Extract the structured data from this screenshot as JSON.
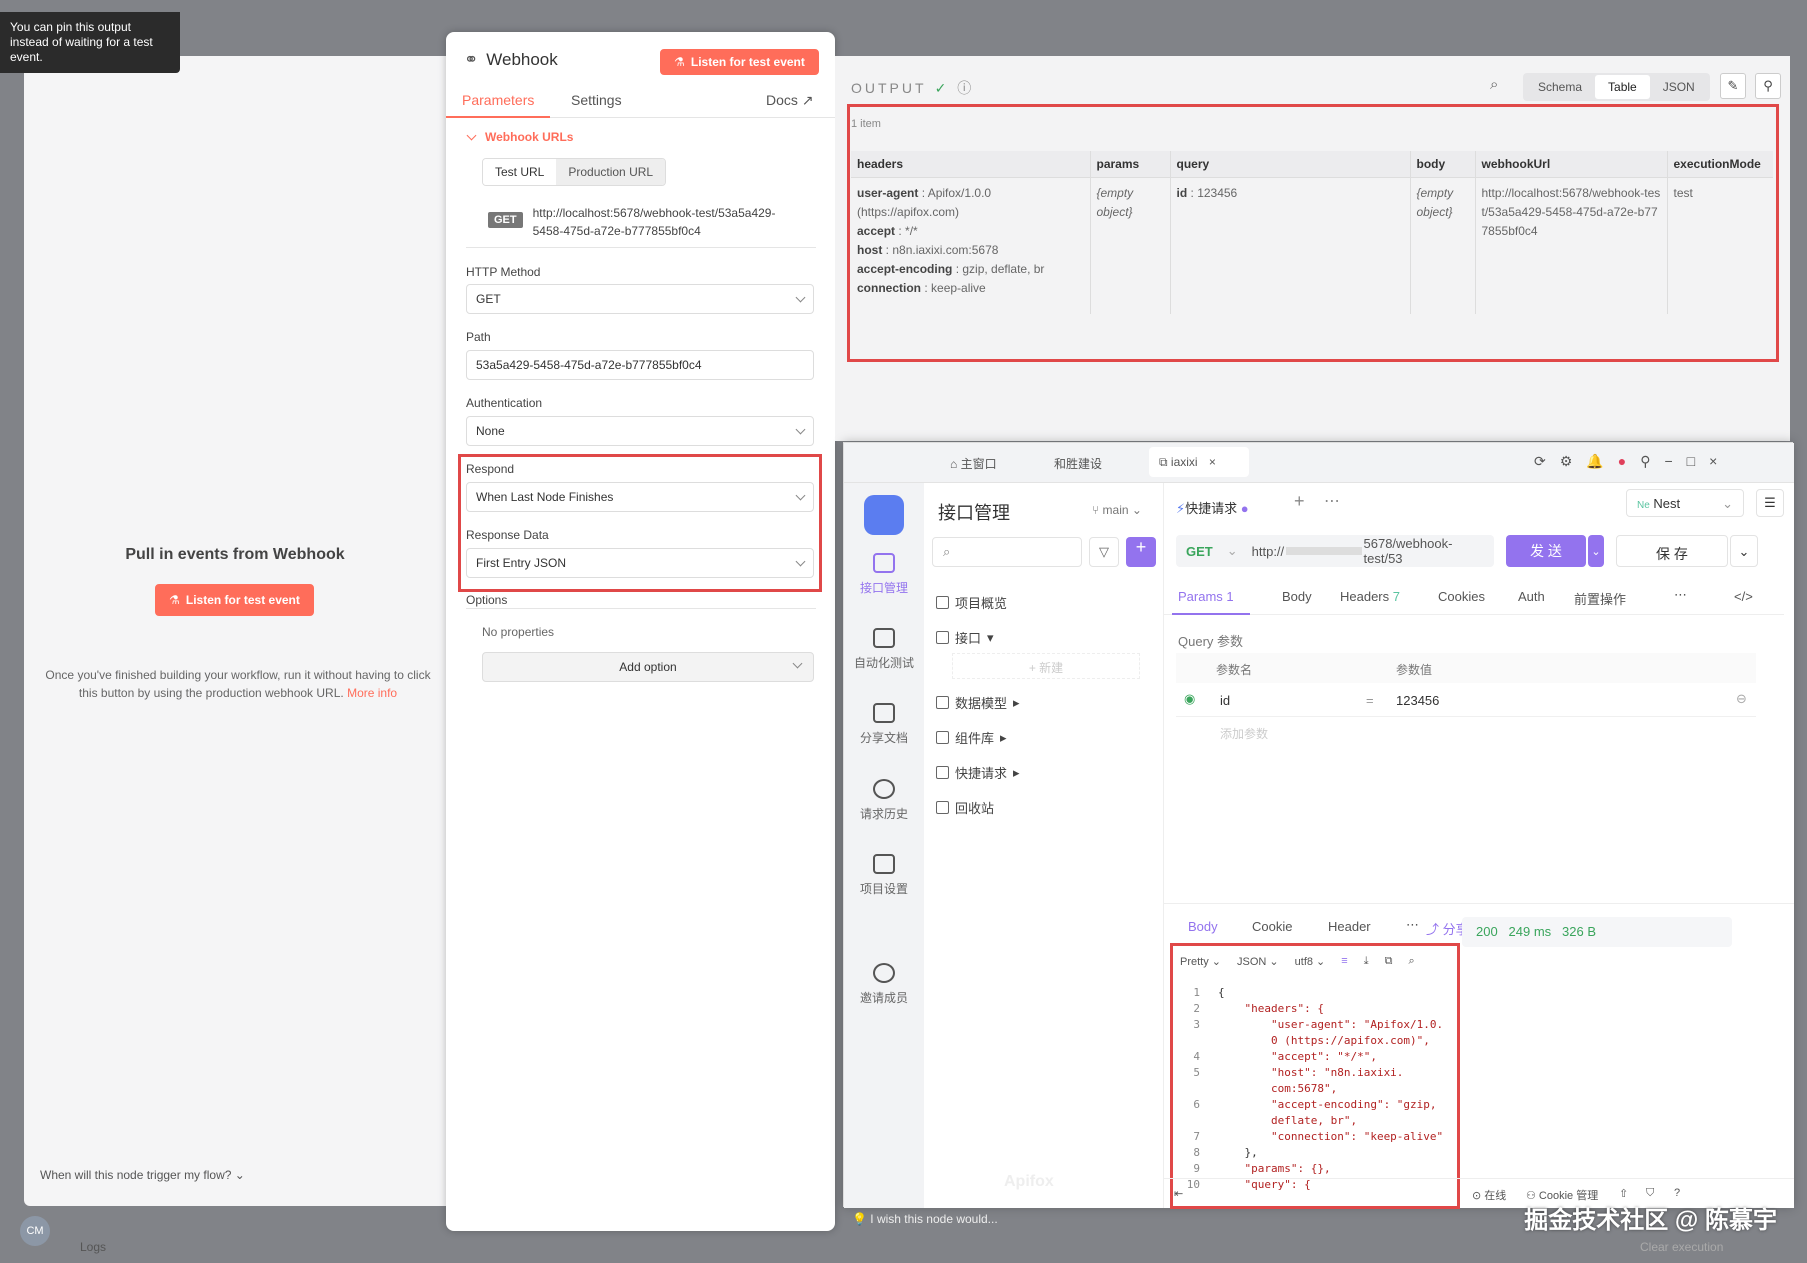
{
  "tooltip": {
    "text": "You can pin this output instead of waiting for a test event."
  },
  "left_pane": {
    "title": "Pull in events from Webhook",
    "listen_button": "Listen for test event",
    "description": "Once you've finished building your workflow, run it without having to click this button by using the production webhook URL.",
    "more_info": "More info",
    "trigger_question": "When will this node trigger my flow?",
    "logs_label": "Logs",
    "avatar_initials": "CM"
  },
  "node_panel": {
    "title": "Webhook",
    "listen_button": "Listen for test event",
    "tabs": [
      "Parameters",
      "Settings"
    ],
    "docs_label": "Docs",
    "webhook_urls_title": "Webhook URLs",
    "url_tabs": [
      "Test URL",
      "Production URL"
    ],
    "method_badge": "GET",
    "url_line1": "http://localhost:5678/webhook-test/53a5a429-",
    "url_line2": "5458-475d-a72e-b777855bf0c4",
    "http_method_label": "HTTP Method",
    "http_method_value": "GET",
    "path_label": "Path",
    "path_value": "53a5a429-5458-475d-a72e-b777855bf0c4",
    "auth_label": "Authentication",
    "auth_value": "None",
    "respond_label": "Respond",
    "respond_value": "When Last Node Finishes",
    "response_data_label": "Response Data",
    "response_data_value": "First Entry JSON",
    "options_label": "Options",
    "no_properties": "No properties",
    "add_option": "Add option"
  },
  "output": {
    "title": "OUTPUT",
    "view_modes": [
      "Schema",
      "Table",
      "JSON"
    ],
    "active_view": "Table",
    "item_count": "1 item",
    "columns": [
      "headers",
      "params",
      "query",
      "body",
      "webhookUrl",
      "executionMode"
    ],
    "headers_rows": [
      {
        "key": "user-agent",
        "value": "Apifox/1.0.0 (https://apifox.com)"
      },
      {
        "key": "accept",
        "value": "*/*"
      },
      {
        "key": "host",
        "value": "n8n.iaxixi.com:5678"
      },
      {
        "key": "accept-encoding",
        "value": "gzip, deflate, br"
      },
      {
        "key": "connection",
        "value": "keep-alive"
      }
    ],
    "params_value": "{empty object}",
    "query_key": "id",
    "query_value": "123456",
    "body_value": "{empty object}",
    "webhook_url_value": "http://localhost:5678/webhook-test/53a5a429-5458-475d-a72e-b777855bf0c4",
    "execution_mode_value": "test",
    "feedback": "I wish this node would...",
    "clear_execution": "Clear execution"
  },
  "apifox": {
    "window_tabs": [
      "主窗口",
      "和胜建设",
      "iaxixi"
    ],
    "nav": [
      "接口管理",
      "自动化测试",
      "分享文档",
      "请求历史",
      "项目设置",
      "邀请成员"
    ],
    "tree_title": "接口管理",
    "branch": "main",
    "tree_items": [
      "项目概览",
      "接口",
      "数据模型",
      "组件库",
      "快捷请求",
      "回收站"
    ],
    "new_label": "+ 新建",
    "request_tab": "快捷请求",
    "env": "Nest",
    "env_badge": "Ne",
    "method": "GET",
    "url_prefix": "http://",
    "url_suffix": "5678/webhook-test/53",
    "send": "发 送",
    "save": "保 存",
    "req_tabs": [
      "Params",
      "Body",
      "Headers",
      "Cookies",
      "Auth",
      "前置操作"
    ],
    "params_count": "1",
    "headers_count": "7",
    "query_title": "Query 参数",
    "col_name": "参数名",
    "col_value": "参数值",
    "param_name": "id",
    "param_value": "123456",
    "add_param": "添加参数",
    "resp_tabs": [
      "Body",
      "Cookie",
      "Header"
    ],
    "share": "分享",
    "status": "200",
    "time": "249 ms",
    "size": "326 B",
    "format": [
      "Pretty",
      "JSON",
      "utf8"
    ],
    "code_lines": [
      {
        "n": "1",
        "t": "{"
      },
      {
        "n": "2",
        "t": "    \"headers\": {"
      },
      {
        "n": "3",
        "t": "        \"user-agent\": \"Apifox/1.0."
      },
      {
        "n": "",
        "t": "        0 (https://apifox.com)\","
      },
      {
        "n": "4",
        "t": "        \"accept\": \"*/*\","
      },
      {
        "n": "5",
        "t": "        \"host\": \"n8n.iaxixi."
      },
      {
        "n": "",
        "t": "        com:5678\","
      },
      {
        "n": "6",
        "t": "        \"accept-encoding\": \"gzip,"
      },
      {
        "n": "",
        "t": "        deflate, br\","
      },
      {
        "n": "7",
        "t": "        \"connection\": \"keep-alive\""
      },
      {
        "n": "8",
        "t": "    },"
      },
      {
        "n": "9",
        "t": "    \"params\": {},"
      },
      {
        "n": "10",
        "t": "    \"query\": {"
      }
    ],
    "footer": [
      "在线",
      "Cookie 管理"
    ],
    "brand": "Apifox"
  },
  "watermark": "掘金技术社区 @ 陈慕宇"
}
